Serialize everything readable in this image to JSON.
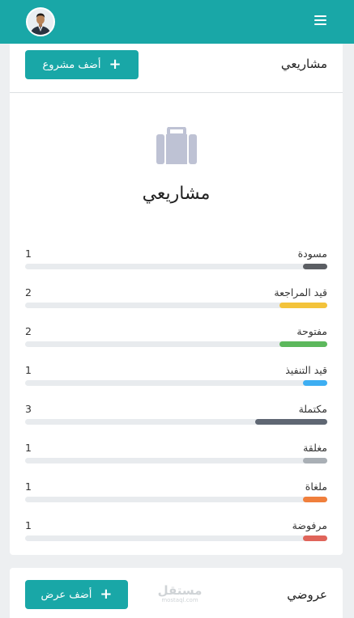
{
  "header": {
    "avatar_alt": "user-avatar"
  },
  "projects": {
    "title": "مشاريعي",
    "add_label": "أضف مشروع",
    "big_title": "مشاريعي",
    "max": 6,
    "stats": [
      {
        "label": "مسودة",
        "count": "1",
        "value": 1,
        "color": "#5b5e63"
      },
      {
        "label": "قيد المراجعة",
        "count": "2",
        "value": 2,
        "color": "#f3c33b"
      },
      {
        "label": "مفتوحة",
        "count": "2",
        "value": 2,
        "color": "#5cb85c"
      },
      {
        "label": "قيد التنفيذ",
        "count": "1",
        "value": 1,
        "color": "#3daef2"
      },
      {
        "label": "مكتملة",
        "count": "3",
        "value": 3,
        "color": "#5f6773"
      },
      {
        "label": "مغلقة",
        "count": "1",
        "value": 1,
        "color": "#a9afb5"
      },
      {
        "label": "ملغاة",
        "count": "1",
        "value": 1,
        "color": "#f07f3c"
      },
      {
        "label": "مرفوضة",
        "count": "1",
        "value": 1,
        "color": "#e0645a"
      }
    ]
  },
  "offers": {
    "title": "عروضي",
    "add_label": "أضف عرض"
  },
  "watermark": {
    "main": "مستقل",
    "sub": "mostaql.com"
  },
  "colors": {
    "brand": "#19a7a7"
  }
}
